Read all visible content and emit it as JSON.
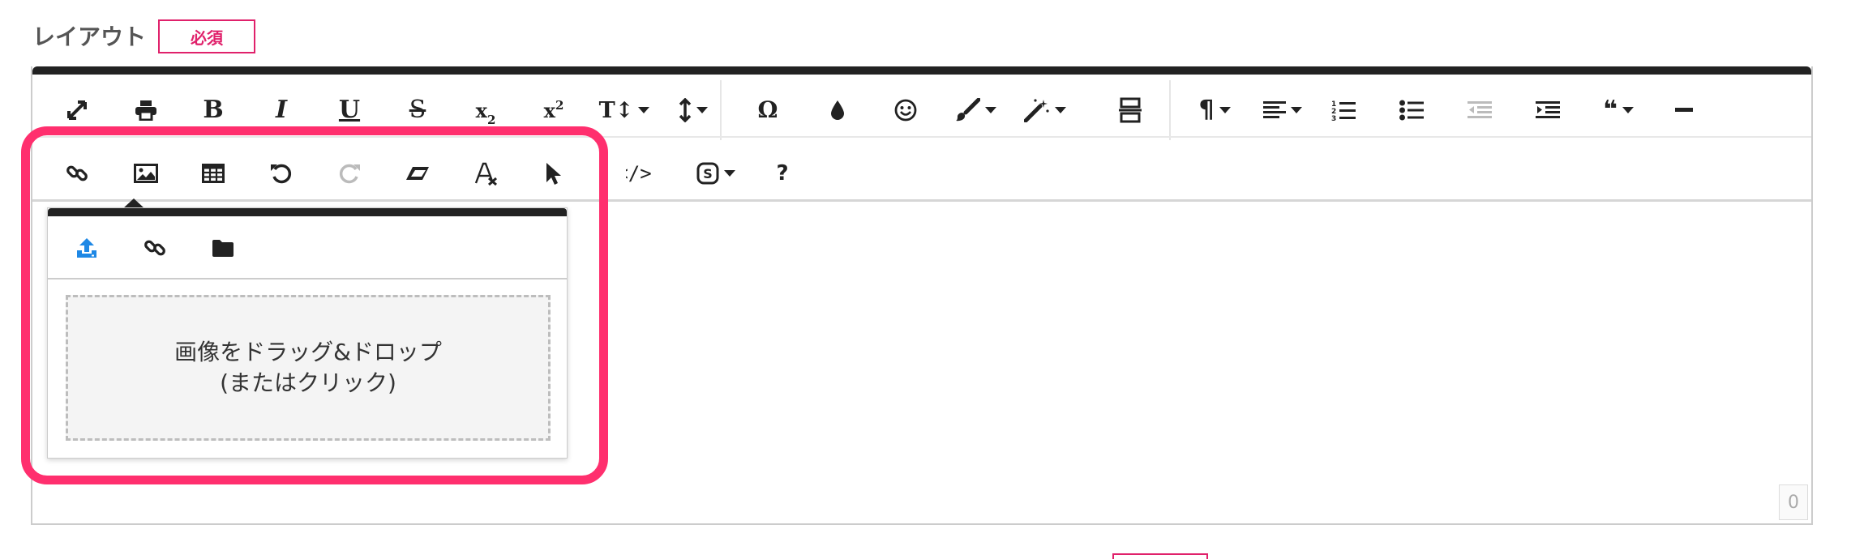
{
  "field": {
    "label": "レイアウト",
    "required_badge": "必須"
  },
  "colors": {
    "accent": "#e0216b",
    "highlight": "#ff2f6e",
    "toolbar_top": "#222222",
    "upload_icon": "#1e88e5"
  },
  "toolbar": {
    "row1": [
      {
        "name": "fullscreen-icon"
      },
      {
        "name": "print-icon"
      },
      {
        "name": "bold-icon",
        "text": "B"
      },
      {
        "name": "italic-icon",
        "text": "I"
      },
      {
        "name": "underline-icon",
        "text": "U"
      },
      {
        "name": "strikethrough-icon",
        "text": "S"
      },
      {
        "name": "subscript-icon",
        "text": "x",
        "small": "2"
      },
      {
        "name": "superscript-icon",
        "text": "x",
        "small": "2"
      },
      {
        "name": "font-size-icon",
        "text": "T↕"
      },
      {
        "name": "line-height-icon"
      },
      {
        "name": "special-char-icon",
        "text": "Ω"
      },
      {
        "name": "color-icon"
      },
      {
        "name": "emoticon-icon"
      },
      {
        "name": "paint-format-icon"
      },
      {
        "name": "magic-wand-icon"
      },
      {
        "name": "page-break-icon"
      },
      {
        "name": "paragraph-icon",
        "text": "¶"
      },
      {
        "name": "align-icon"
      },
      {
        "name": "ordered-list-icon"
      },
      {
        "name": "unordered-list-icon"
      },
      {
        "name": "outdent-icon"
      },
      {
        "name": "indent-icon"
      },
      {
        "name": "quote-icon",
        "text": "❝"
      },
      {
        "name": "horizontal-rule-icon"
      }
    ],
    "row2": [
      {
        "name": "link-icon"
      },
      {
        "name": "image-icon"
      },
      {
        "name": "table-icon"
      },
      {
        "name": "undo-icon"
      },
      {
        "name": "redo-icon"
      },
      {
        "name": "eraser-icon"
      },
      {
        "name": "clear-format-icon"
      },
      {
        "name": "select-all-icon"
      },
      {
        "name": "code-view-icon",
        "text": "</>"
      },
      {
        "name": "special-icon"
      },
      {
        "name": "help-icon",
        "text": "?"
      }
    ]
  },
  "image_popup": {
    "tabs": [
      "upload-icon",
      "link-icon",
      "folder-icon"
    ],
    "drop_line1": "画像をドラッグ&ドロップ",
    "drop_line2": "(またはクリック)"
  },
  "counter": "0"
}
